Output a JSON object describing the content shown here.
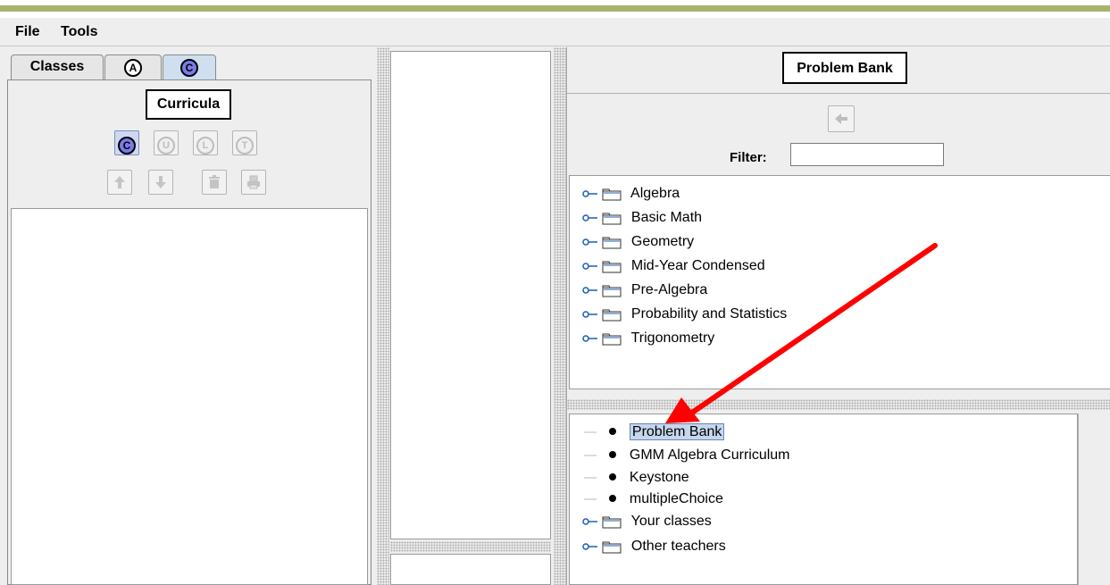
{
  "menubar": {
    "file": "File",
    "tools": "Tools"
  },
  "left": {
    "tabs": [
      {
        "label": "Classes"
      },
      {
        "label": "A"
      },
      {
        "label": "C",
        "active": true
      }
    ],
    "title": "Curricula",
    "buttons_row1": [
      "C",
      "U",
      "L",
      "T"
    ],
    "up_icon": "arrow-up-icon",
    "down_icon": "arrow-down-icon",
    "trash_icon": "trash-icon",
    "print_icon": "print-icon"
  },
  "right": {
    "title": "Problem Bank",
    "back_icon": "back-arrow-icon",
    "filter_label": "Filter:",
    "filter_value": "",
    "topics": [
      "Algebra",
      "Basic Math",
      "Geometry",
      "Mid-Year Condensed",
      "Pre-Algebra",
      "Probability and Statistics",
      "Trigonometry"
    ],
    "sources": [
      {
        "label": "Problem Bank",
        "kind": "leaf",
        "selected": true
      },
      {
        "label": "GMM Algebra Curriculum",
        "kind": "leaf"
      },
      {
        "label": "Keystone",
        "kind": "leaf"
      },
      {
        "label": "multipleChoice",
        "kind": "leaf"
      },
      {
        "label": "Your classes",
        "kind": "folder"
      },
      {
        "label": "Other teachers",
        "kind": "folder"
      }
    ]
  },
  "annotation": {
    "arrow_color": "#ff0000"
  }
}
